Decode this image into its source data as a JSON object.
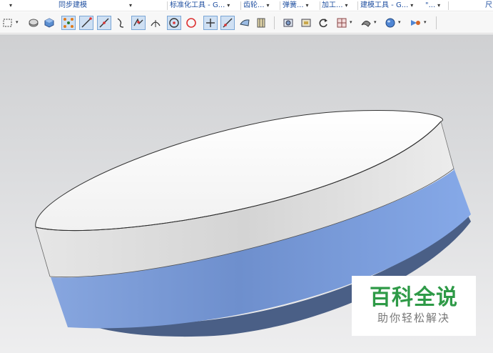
{
  "ribbon_groups": [
    {
      "label": "同步建模"
    },
    {
      "label": "标准化工具 - G..."
    },
    {
      "label": "齿轮..."
    },
    {
      "label": "弹簧..."
    },
    {
      "label": "加工..."
    },
    {
      "label": "建模工具 - G..."
    },
    {
      "label": "\"..."
    },
    {
      "label": "尺"
    }
  ],
  "toolbar_icons": [
    "select-box-icon",
    "render-style-icon",
    "cube-icon",
    "snap-points-icon",
    "line-endpoint-icon",
    "line-midpoint-icon",
    "curve-point-icon",
    "intersection-point-icon",
    "tangent-point-icon",
    "center-point-icon",
    "quadrant-point-icon",
    "existing-point-icon",
    "point-on-curve-icon",
    "point-on-surface-icon",
    "bounded-grid-icon",
    "view-camera-icon",
    "view-frame-icon",
    "rotate-view-icon",
    "layout-grid-icon",
    "face-analysis-icon",
    "shaded-sphere-icon",
    "show-hide-icon"
  ],
  "colors": {
    "ribbon_label": "#1f4fa0",
    "top_face": "#f3f3f3",
    "white_band": "#e4e4e4",
    "blue_band": "#7f9fdc",
    "blue_dark": "#3f5a8e",
    "watermark_green": "#2e9a47"
  },
  "watermark": {
    "title": "百科全说",
    "subtitle": "助你轻松解决"
  }
}
